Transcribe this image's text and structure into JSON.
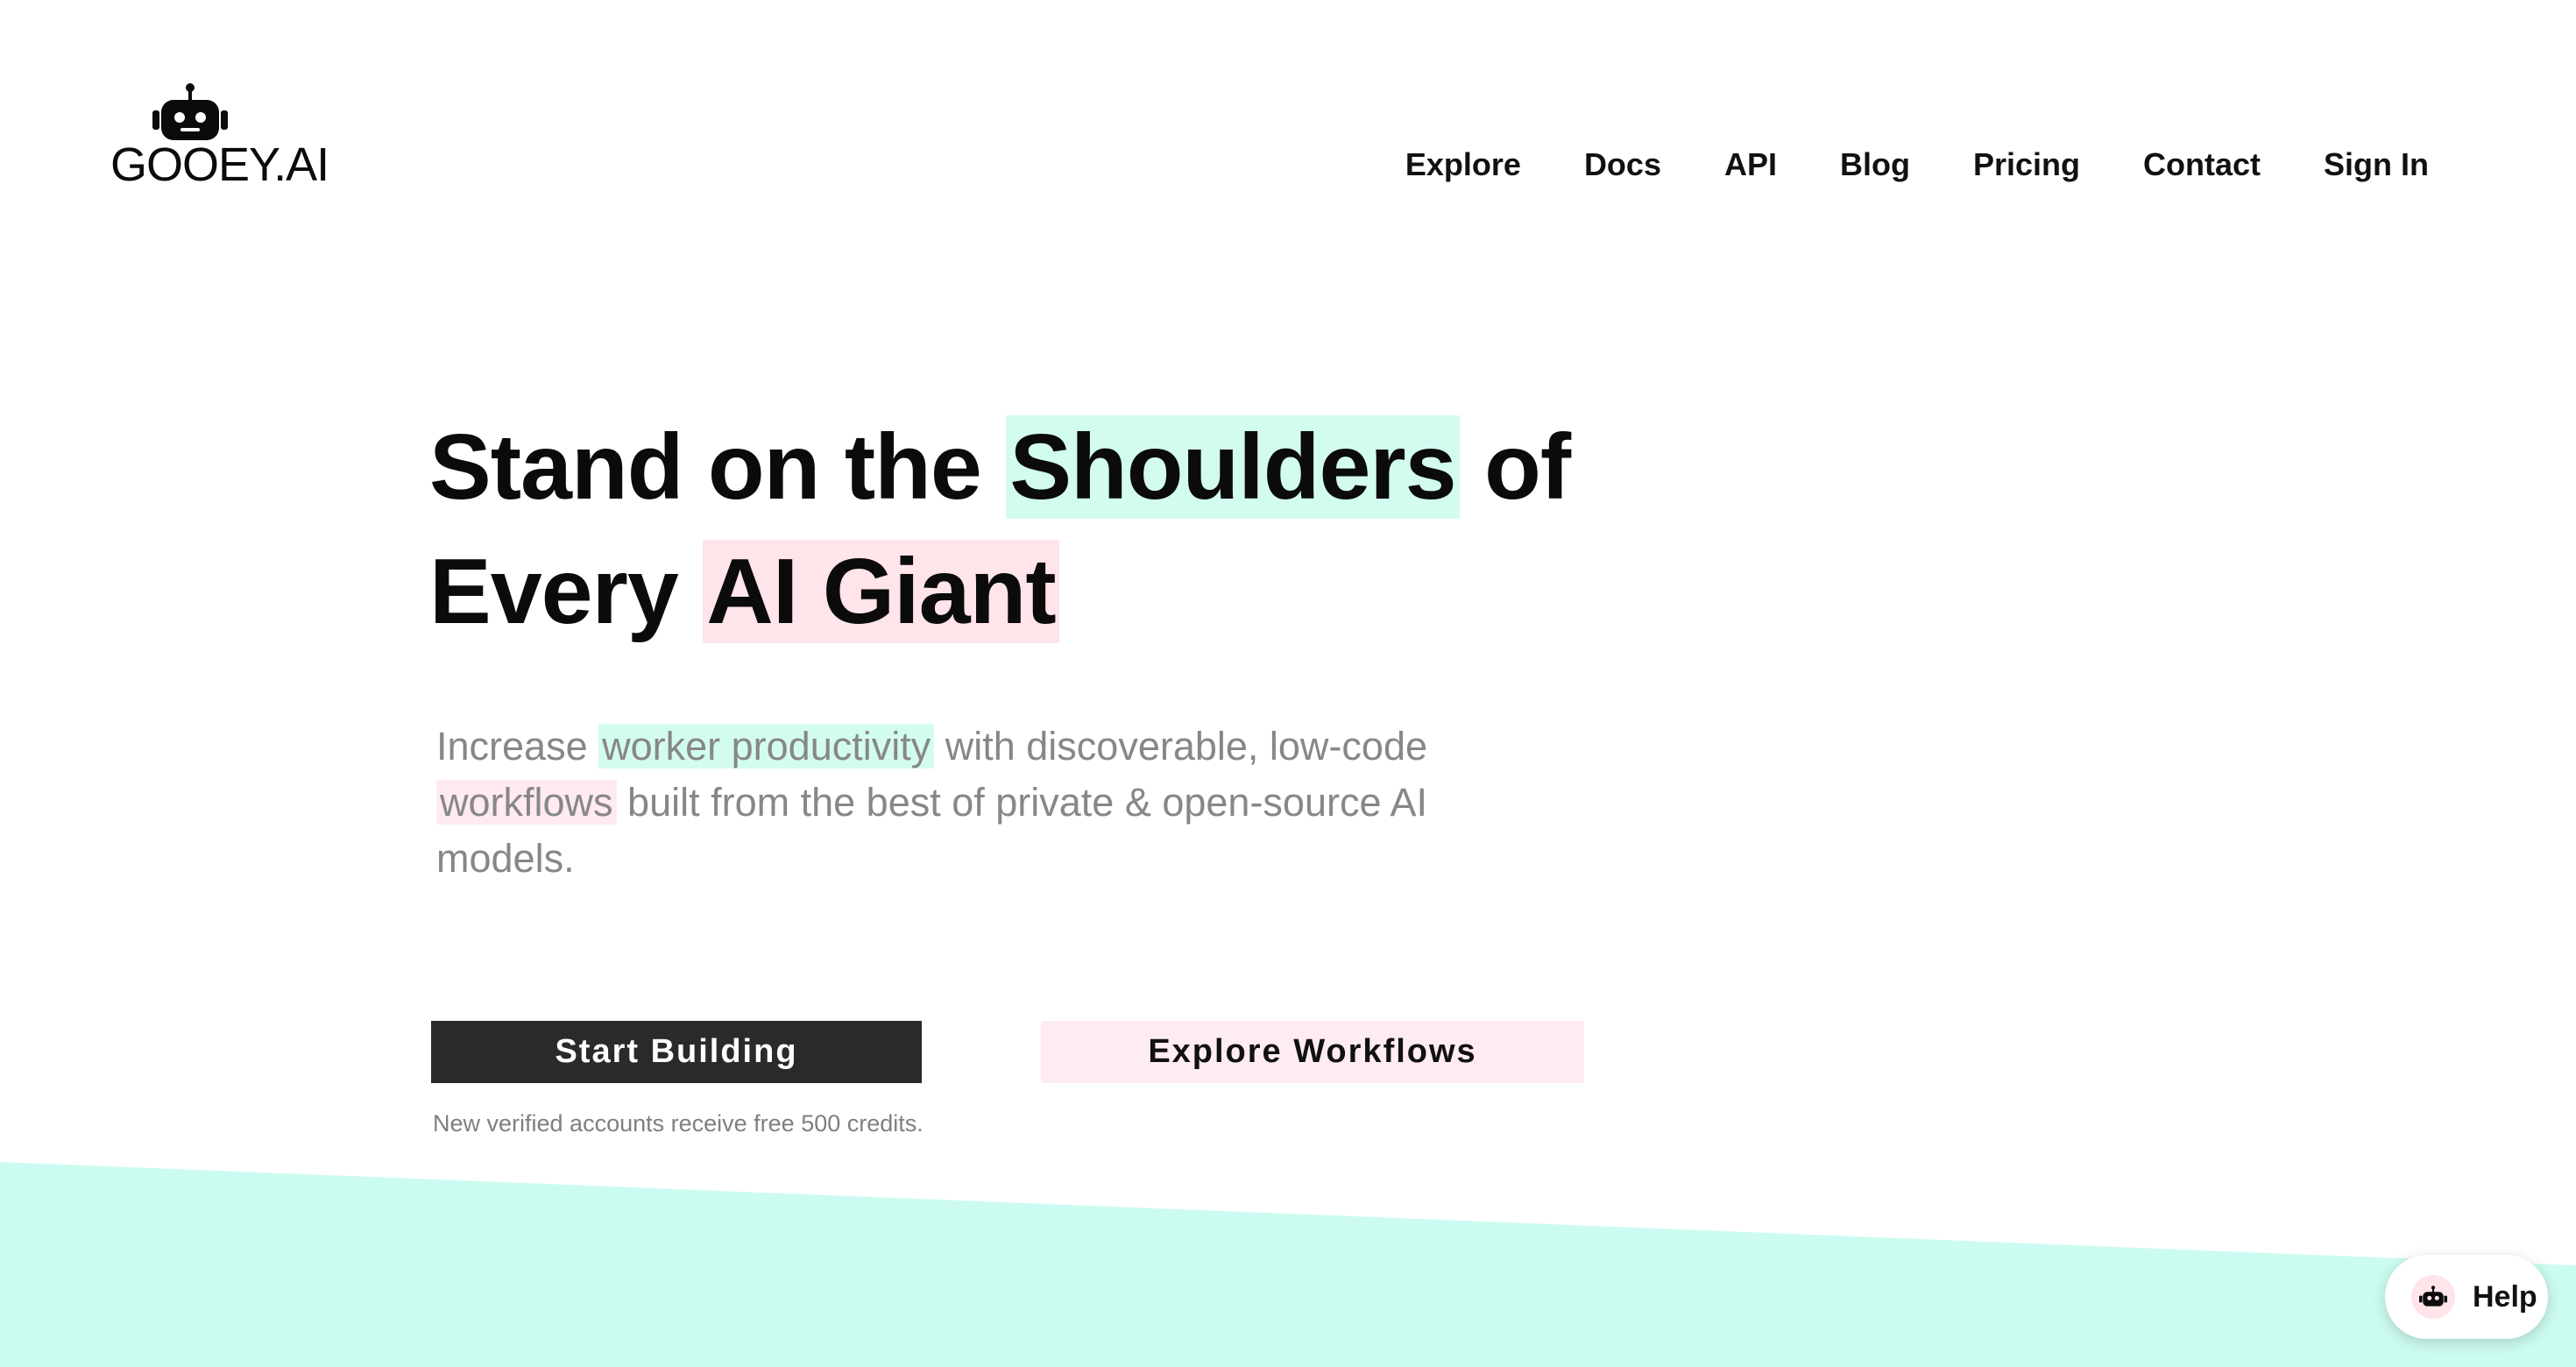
{
  "header": {
    "logo_text": "GOOEY.AI",
    "logo_icon": "robot-icon",
    "nav": [
      {
        "label": "Explore"
      },
      {
        "label": "Docs"
      },
      {
        "label": "API"
      },
      {
        "label": "Blog"
      },
      {
        "label": "Pricing"
      },
      {
        "label": "Contact"
      },
      {
        "label": "Sign In"
      }
    ]
  },
  "hero": {
    "title": {
      "part1": "Stand on the ",
      "highlight1": "Shoulders",
      "part2": " of",
      "part3": "Every ",
      "highlight2": "AI Giant"
    },
    "subtitle": {
      "part1": "Increase ",
      "highlight1": "worker productivity",
      "part2": " with discoverable, low-code ",
      "highlight2": "workflows",
      "part3": " built from the best of private & open-source AI models."
    },
    "primary_button": "Start Building",
    "secondary_button": "Explore Workflows",
    "note": "New verified accounts receive free 500 credits."
  },
  "help_widget": {
    "label": "Help",
    "icon": "robot-icon"
  },
  "colors": {
    "mint": "#d3fcf1",
    "pink": "#ffe4ea",
    "dark_button": "#2a2a2a",
    "text": "#0b0b0b",
    "muted_text": "#878787",
    "band": "#ccfcf1"
  }
}
